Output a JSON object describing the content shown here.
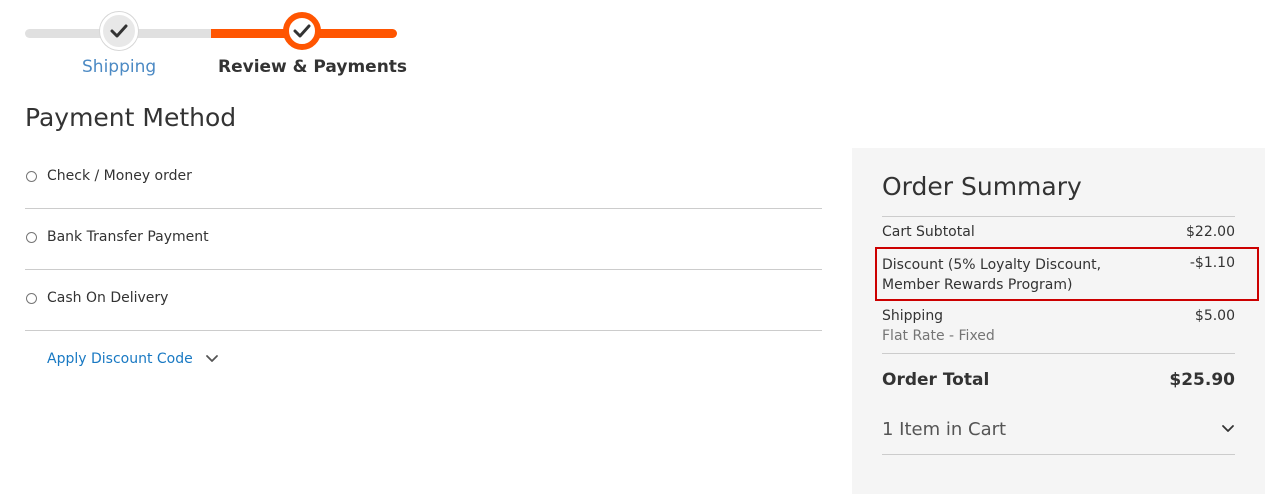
{
  "progress": {
    "steps": [
      {
        "label": "Shipping",
        "state": "complete"
      },
      {
        "label": "Review & Payments",
        "state": "active"
      }
    ]
  },
  "payment": {
    "title": "Payment Method",
    "options": [
      {
        "label": "Check / Money order"
      },
      {
        "label": "Bank Transfer Payment"
      },
      {
        "label": "Cash On Delivery"
      }
    ],
    "discount_toggle_label": "Apply Discount Code"
  },
  "summary": {
    "title": "Order Summary",
    "cart_subtotal_label": "Cart Subtotal",
    "cart_subtotal_value": "$22.00",
    "discount_label": "Discount (5% Loyalty Discount, Member Rewards Program)",
    "discount_value": "-$1.10",
    "shipping_label": "Shipping",
    "shipping_method": "Flat Rate - Fixed",
    "shipping_value": "$5.00",
    "order_total_label": "Order Total",
    "order_total_value": "$25.90",
    "items_in_cart_label": "1 Item in Cart"
  },
  "colors": {
    "accent": "#ff5501",
    "link": "#1979c3",
    "step_link": "#4c8ac4",
    "highlight": "#cc0000",
    "summary_bg": "#f5f5f5"
  },
  "icons": {
    "step_complete": "checkmark-icon",
    "expand": "chevron-down-icon"
  }
}
